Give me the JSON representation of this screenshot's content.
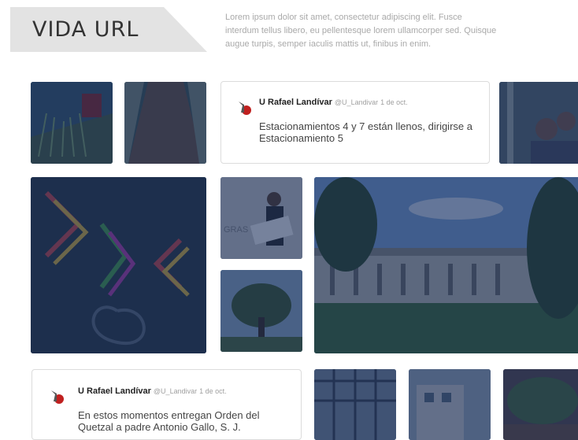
{
  "header": {
    "title": "VIDA URL",
    "intro": "Lorem ipsum dolor sit amet, consectetur adipiscing elit. Fusce interdum tellus libero, eu pellentesque lorem ullamcorper sed. Quisque augue turpis, semper iaculis mattis ut, finibus in enim."
  },
  "tweets": [
    {
      "author": "U Rafael Landívar",
      "handle": "@U_Landivar",
      "date": "1 de oct.",
      "text": "Estacionamientos 4 y 7 están llenos, dirigirse a Estacionamiento 5"
    },
    {
      "author": "U Rafael Landívar",
      "handle": "@U_Landivar",
      "date": "1 de oct.",
      "text": "En estos momentos entregan Orden del Quetzal a padre Antonio Gallo, S. J."
    }
  ],
  "colors": {
    "overlay": "#102656",
    "banner": "#e3e3e3",
    "intro_text": "#a9a9a9"
  },
  "icons": [
    "university-logo-icon"
  ]
}
